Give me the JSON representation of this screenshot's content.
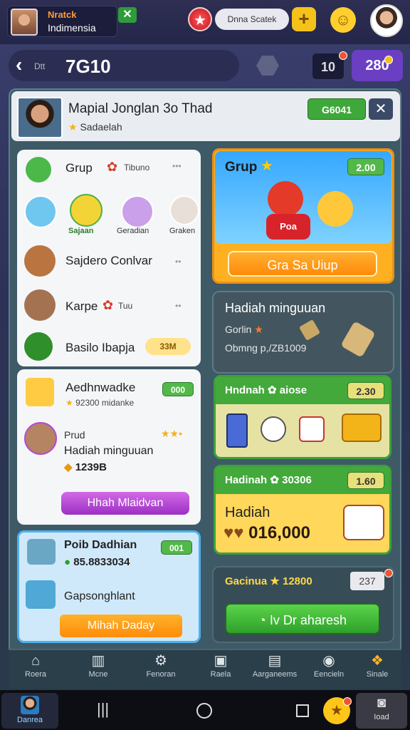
{
  "top": {
    "profile_name": "Nratck",
    "profile_region": "Indimensia",
    "search_text": "Dnna Scatek",
    "plus_symbol": "+",
    "star_symbol": "★"
  },
  "subbar": {
    "back_label": "Dtt",
    "level": "7G10",
    "mail_count": "10",
    "coins": "280"
  },
  "header": {
    "title": "Mapial Jonglan 3o Thad",
    "subtitle": "Sadaelah",
    "score": "G6041",
    "close": "✕"
  },
  "left": {
    "group_title": "Grup",
    "group_tag": "Tibuno",
    "avatars": [
      {
        "label": ""
      },
      {
        "label": "Sajaan"
      },
      {
        "label": "Geradian"
      },
      {
        "label": "Graken"
      }
    ],
    "row_1": "Sajdero Conlvar",
    "row_2": "Karpe",
    "row_2_tag": "Tuu",
    "row_3": "Basilo Ibapja",
    "row_3_value": "33M",
    "card2_title": "Aedhnwadke",
    "card2_value": "000",
    "card2_sub": "92300 midanke",
    "card2_user": "Prud",
    "card2_text": "Hadiah minguuan",
    "card2_amount": "1239B",
    "card2_button": "Hhah Mlaidvan",
    "card3_title": "Poib Dadhian",
    "card3_value": "001",
    "card3_amount": "85.8833034",
    "card3_text": "Gapsonghlant",
    "card3_button": "Mihah Daday"
  },
  "right": {
    "group_title": "Grup",
    "group_score": "2.00",
    "group_shirt": "Poa",
    "group_button": "Gra Sa Uiup",
    "weekly_title": "Hadiah minguuan",
    "weekly_line1": "Gorlin",
    "weekly_line2": "Obmng p,/ZB1009",
    "reward1_title": "Hndnah",
    "reward1_code": "aiose",
    "reward1_value": "2.30",
    "reward2_title": "Hadinah",
    "reward2_code": "30306",
    "reward2_value": "1.60",
    "reward2_label": "Hadiah",
    "reward2_amount": "016,000",
    "bottom_title": "Gacinua",
    "bottom_code": "12800",
    "bottom_value": "237",
    "bottom_button": "Iv Dr aharesh"
  },
  "tabs": [
    {
      "label": "Roera",
      "icon": "home-icon",
      "glyph": "⌂"
    },
    {
      "label": "Mcne",
      "icon": "grid-icon",
      "glyph": "▥"
    },
    {
      "label": "Fenoran",
      "icon": "gear-icon",
      "glyph": "⚙"
    },
    {
      "label": "Raela",
      "icon": "chart-icon",
      "glyph": "▣"
    },
    {
      "label": "Aarganeems",
      "icon": "trophy-icon",
      "glyph": "▤"
    },
    {
      "label": "Eencieln",
      "icon": "target-icon",
      "glyph": "◉"
    },
    {
      "label": "Sinale",
      "icon": "bag-icon",
      "glyph": "❖"
    }
  ],
  "sysnav": {
    "profile_label": "Danrea",
    "load_label": "Ioad"
  }
}
